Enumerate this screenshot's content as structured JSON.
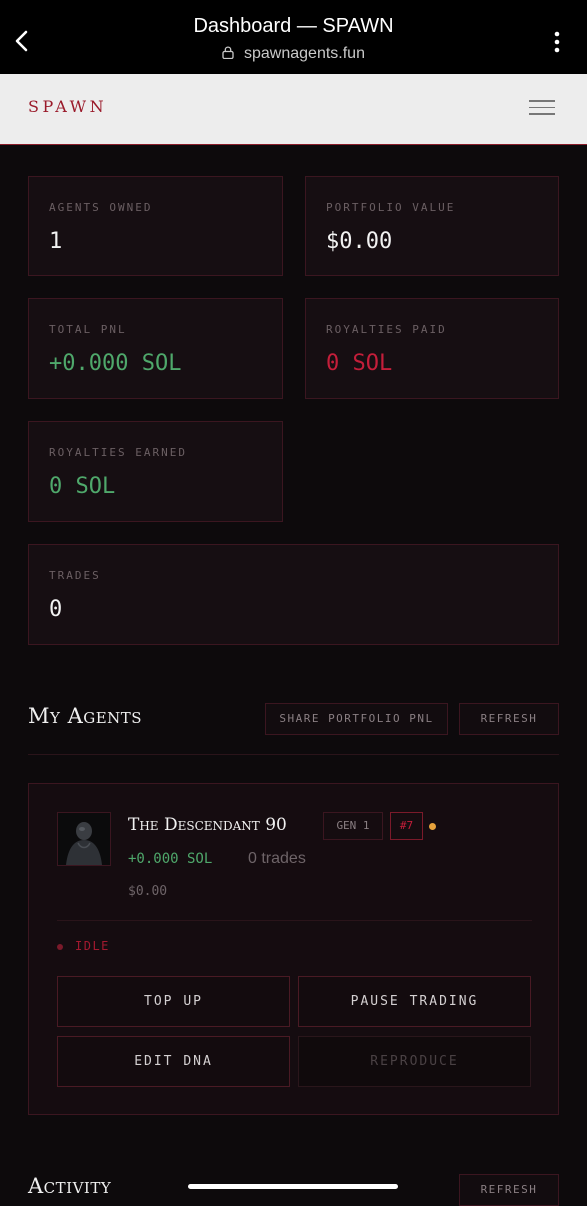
{
  "browser": {
    "title": "Dashboard — SPAWN",
    "url": "spawnagents.fun"
  },
  "header": {
    "logo": "SPAWN"
  },
  "stats": {
    "agents_owned": {
      "label": "AGENTS OWNED",
      "value": "1"
    },
    "portfolio_value": {
      "label": "PORTFOLIO VALUE",
      "value": "$0.00"
    },
    "total_pnl": {
      "label": "TOTAL PNL",
      "value": "+0.000 SOL"
    },
    "royalties_paid": {
      "label": "ROYALTIES PAID",
      "value": "0 SOL"
    },
    "royalties_earned": {
      "label": "ROYALTIES EARNED",
      "value": "0 SOL"
    },
    "trades": {
      "label": "TRADES",
      "value": "0"
    }
  },
  "my_agents": {
    "title": "My Agents",
    "share_label": "SHARE PORTFOLIO PNL",
    "refresh_label": "REFRESH",
    "agent": {
      "name": "The Descendant 90",
      "gen": "GEN 1",
      "rank": "#7",
      "pnl": "+0.000 SOL",
      "trades": "0 trades",
      "value": "$0.00",
      "status": "IDLE",
      "actions": {
        "top_up": "TOP UP",
        "pause": "PAUSE TRADING",
        "edit_dna": "EDIT DNA",
        "reproduce": "REPRODUCE"
      }
    }
  },
  "activity": {
    "title": "Activity",
    "refresh_label": "REFRESH"
  },
  "colors": {
    "background": "#0d0a0c",
    "accent": "#c41e3a",
    "positive": "#4fa86b",
    "card_border": "#3b1620",
    "status_dot": "#e6a23c"
  }
}
